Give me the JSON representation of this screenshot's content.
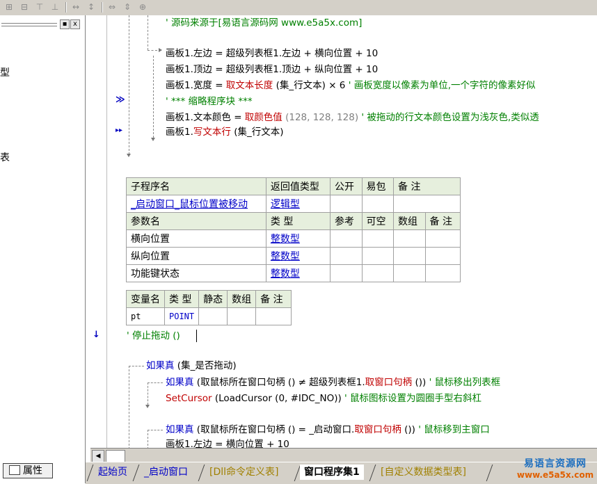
{
  "toolbar": {
    "icons": [
      "align-left-icon",
      "align-center-icon",
      "align-top-icon",
      "align-middle-icon",
      "space-horizontal-icon",
      "space-vertical-icon",
      "same-width-icon",
      "same-height-icon",
      "same-size-icon"
    ]
  },
  "left_panel": {
    "frag1": "型",
    "frag2": "表",
    "properties_tab": "属性",
    "min_glyph": "▪",
    "close_glyph": "x"
  },
  "code_top": {
    "line0": "' 源码来源于[易语言源码网 www.e5a5x.com]",
    "line1_obj": "画板1.左边",
    "line1_eq": "=",
    "line1_rhs": "超级列表框1.左边",
    "line1_op1": "+",
    "line1_v1": "横向位置",
    "line1_op2": "+",
    "line1_num": "10",
    "line2_obj": "画板1.顶边",
    "line2_eq": "=",
    "line2_rhs": "超级列表框1.顶边",
    "line2_op1": "+",
    "line2_v1": "纵向位置",
    "line2_op2": "+",
    "line2_num": "10",
    "line3_obj": "画板1.宽度",
    "line3_eq": "=",
    "line3_fn": "取文本长度",
    "line3_arg": "(集_行文本)",
    "line3_mul": "× 6",
    "line3_cm": "' 画板宽度以像素为单位,一个字符的像素好似",
    "line4_cm": "' *** 缩略程序块 ***",
    "line5_obj": "画板1.文本颜色",
    "line5_eq": "=",
    "line5_fn": "取颜色值",
    "line5_args": "(128, 128, 128)",
    "line5_cm": "' 被拖动的行文本颜色设置为浅灰色,类似透",
    "line6_obj": "画板1.",
    "line6_fn": "写文本行",
    "line6_arg": "(集_行文本)"
  },
  "sub_table": {
    "headers": [
      "子程序名",
      "返回值类型",
      "公开",
      "易包",
      "备 注"
    ],
    "name": "_启动窗口_鼠标位置被移动",
    "return_type": "逻辑型",
    "param_headers": [
      "参数名",
      "类 型",
      "参考",
      "可空",
      "数组",
      "备 注"
    ],
    "params": [
      {
        "name": "横向位置",
        "type": "整数型"
      },
      {
        "name": "纵向位置",
        "type": "整数型"
      },
      {
        "name": "功能键状态",
        "type": "整数型"
      }
    ]
  },
  "var_table": {
    "headers": [
      "变量名",
      "类 型",
      "静态",
      "数组",
      "备 注"
    ],
    "rows": [
      {
        "name": "pt",
        "type": "POINT"
      }
    ]
  },
  "code_bottom": {
    "stop_drag": "' 停止拖动 ()",
    "if1_kw": "如果真",
    "if1_arg": "(集_是否拖动)",
    "if2_kw": "如果真",
    "if2_fn": "(取鼠标所在窗口句柄 () ≠ 超级列表框1.",
    "if2_fn2": "取窗口句柄",
    "if2_end": "())",
    "if2_cm": "' 鼠标移出列表框",
    "setcursor_fn": "SetCursor",
    "setcursor_arg1": "(LoadCursor",
    "setcursor_arg2": "(0, #IDC_NO))",
    "setcursor_cm": "' 鼠标图标设置为圆圈手型右斜杠",
    "if3_kw": "如果真",
    "if3_fn": "(取鼠标所在窗口句柄 () = _启动窗口.",
    "if3_fn2": "取窗口句柄",
    "if3_end": "())",
    "if3_cm": "' 鼠标移到主窗口",
    "last_line": "画板1.左边 = 横向位置 + 10"
  },
  "tabs": [
    "起始页",
    "_启动窗口",
    "[Dll命令定义表]",
    "窗口程序集1",
    "[自定义数据类型表]"
  ],
  "watermark": {
    "line1": "易语言资源网",
    "line2": "www.e5a5x.com"
  },
  "colors": {
    "keyword_fn": "#c00000",
    "type_blue": "#0000c8",
    "comment": "#008000",
    "header_bg": "#e6efdd",
    "toolbar_bg": "#d4d0c8"
  }
}
